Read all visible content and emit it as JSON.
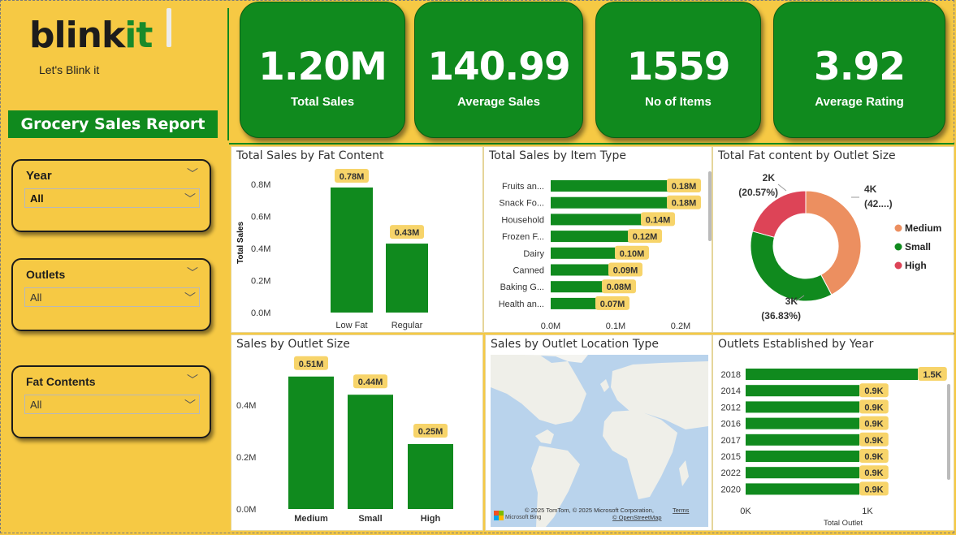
{
  "brand": {
    "logo_main": "blink",
    "logo_accent": "it",
    "tagline": "Let's Blink it",
    "report_title": "Grocery Sales Report"
  },
  "slicers": [
    {
      "label": "Year",
      "value": "All"
    },
    {
      "label": "Outlets",
      "value": "All"
    },
    {
      "label": "Fat Contents",
      "value": "All"
    }
  ],
  "kpis": [
    {
      "value": "1.20M",
      "label": "Total Sales"
    },
    {
      "value": "140.99",
      "label": "Average Sales"
    },
    {
      "value": "1559",
      "label": "No of Items"
    },
    {
      "value": "3.92",
      "label": "Average Rating"
    }
  ],
  "colors": {
    "green": "#108a1e",
    "yellow": "#f6c944",
    "label_bg": "#f7d46a",
    "medium": "#ec8f60",
    "small": "#108a1e",
    "high": "#dd4457"
  },
  "chart_data": [
    {
      "type": "bar",
      "title": "Total Sales by Fat Content",
      "categories": [
        "Low Fat",
        "Regular"
      ],
      "values": [
        0.78,
        0.43
      ],
      "labels": [
        "0.78M",
        "0.43M"
      ],
      "ylabel": "Total Sales",
      "yticks": [
        "0.0M",
        "0.2M",
        "0.4M",
        "0.6M",
        "0.8M"
      ],
      "ylim": [
        0,
        0.8
      ]
    },
    {
      "type": "bar",
      "orientation": "horizontal",
      "title": "Total Sales by Item Type",
      "categories": [
        "Fruits an...",
        "Snack Fo...",
        "Household",
        "Frozen F...",
        "Dairy",
        "Canned",
        "Baking G...",
        "Health an..."
      ],
      "values": [
        0.18,
        0.18,
        0.14,
        0.12,
        0.1,
        0.09,
        0.08,
        0.07
      ],
      "labels": [
        "0.18M",
        "0.18M",
        "0.14M",
        "0.12M",
        "0.10M",
        "0.09M",
        "0.08M",
        "0.07M"
      ],
      "xticks": [
        "0.0M",
        "0.1M",
        "0.2M"
      ],
      "xlim": [
        0,
        0.2
      ]
    },
    {
      "type": "pie",
      "title": "Total Fat content by Outlet Size",
      "donut": true,
      "slices": [
        {
          "name": "Medium",
          "value": 42,
          "label": "4K",
          "pct": "(42....)"
        },
        {
          "name": "Small",
          "value": 36.83,
          "label": "3K",
          "pct": "(36.83%)"
        },
        {
          "name": "High",
          "value": 20.57,
          "label": "2K",
          "pct": "(20.57%)"
        }
      ]
    },
    {
      "type": "bar",
      "title": "Sales by Outlet Size",
      "categories": [
        "Medium",
        "Small",
        "High"
      ],
      "values": [
        0.51,
        0.44,
        0.25
      ],
      "labels": [
        "0.51M",
        "0.44M",
        "0.25M"
      ],
      "yticks": [
        "0.0M",
        "0.2M",
        "0.4M"
      ],
      "ylim": [
        0,
        0.5
      ]
    },
    {
      "type": "map",
      "title": "Sales by Outlet Location Type",
      "attribution": "© 2025 TomTom, © 2025 Microsoft Corporation,",
      "terms": "Terms",
      "osm": "© OpenStreetMap",
      "provider": "Microsoft Bing"
    },
    {
      "type": "bar",
      "orientation": "horizontal",
      "title": "Outlets Established by Year",
      "categories": [
        "2018",
        "2014",
        "2012",
        "2016",
        "2017",
        "2015",
        "2022",
        "2020"
      ],
      "values": [
        1.5,
        0.9,
        0.9,
        0.9,
        0.9,
        0.9,
        0.9,
        0.9
      ],
      "labels": [
        "1.5K",
        "0.9K",
        "0.9K",
        "0.9K",
        "0.9K",
        "0.9K",
        "0.9K",
        "0.9K"
      ],
      "xticks": [
        "0K",
        "1K"
      ],
      "xlabel": "Total Outlet",
      "xlim": [
        0,
        1.5
      ]
    }
  ]
}
